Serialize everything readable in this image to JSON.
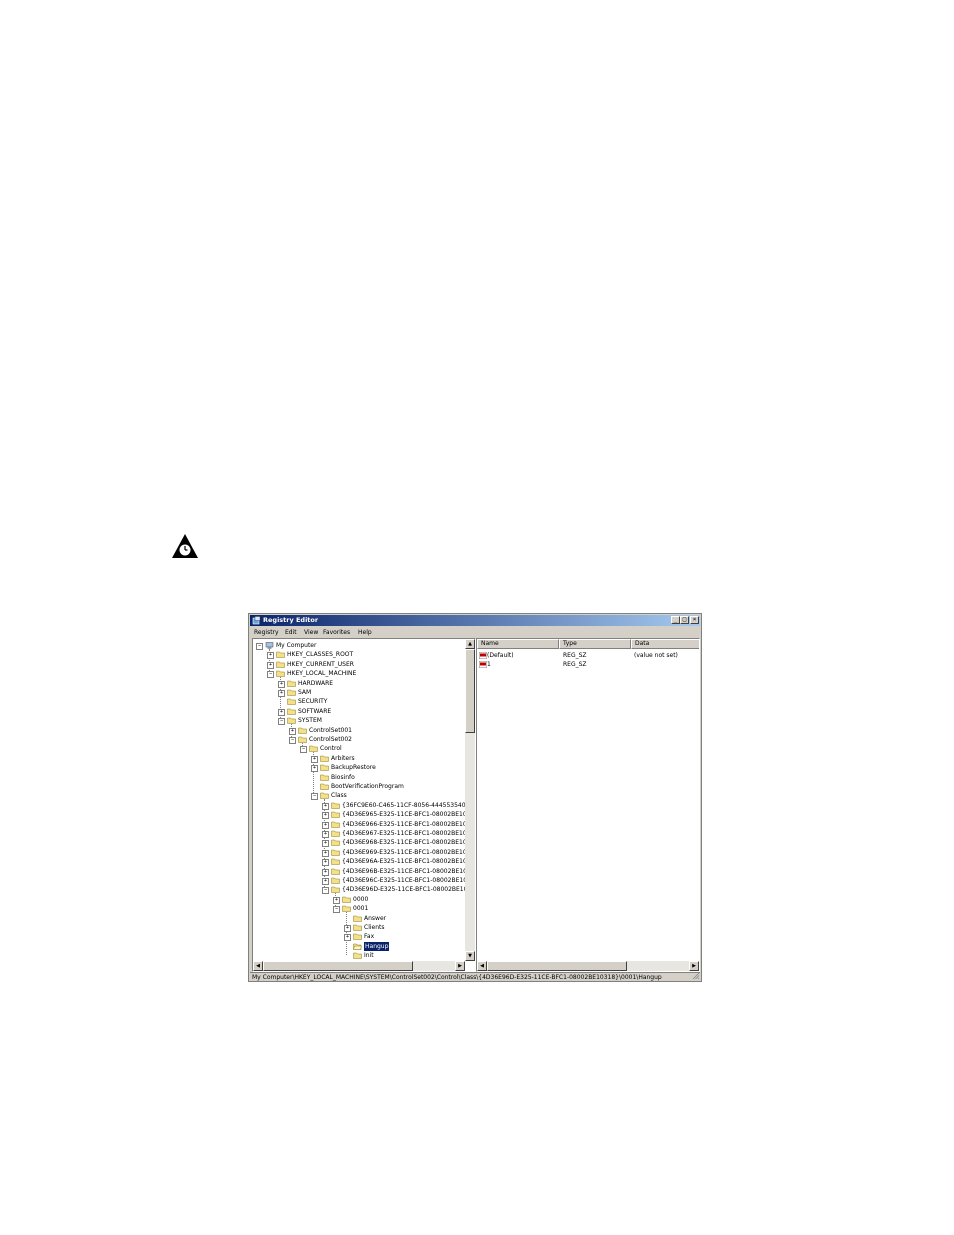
{
  "window": {
    "title": "Registry Editor",
    "minimize": "_",
    "maximize": "□",
    "close": "×"
  },
  "menu": [
    "Registry",
    "Edit",
    "View",
    "Favorites",
    "Help"
  ],
  "tree": [
    {
      "label": "My Computer",
      "level": 0,
      "exp": "-",
      "icon": "computer-icon"
    },
    {
      "label": "HKEY_CLASSES_ROOT",
      "level": 1,
      "exp": "+"
    },
    {
      "label": "HKEY_CURRENT_USER",
      "level": 1,
      "exp": "+"
    },
    {
      "label": "HKEY_LOCAL_MACHINE",
      "level": 1,
      "exp": "-"
    },
    {
      "label": "HARDWARE",
      "level": 2,
      "exp": "+"
    },
    {
      "label": "SAM",
      "level": 2,
      "exp": "+"
    },
    {
      "label": "SECURITY",
      "level": 2,
      "exp": ""
    },
    {
      "label": "SOFTWARE",
      "level": 2,
      "exp": "+"
    },
    {
      "label": "SYSTEM",
      "level": 2,
      "exp": "-"
    },
    {
      "label": "ControlSet001",
      "level": 3,
      "exp": "+"
    },
    {
      "label": "ControlSet002",
      "level": 3,
      "exp": "-"
    },
    {
      "label": "Control",
      "level": 4,
      "exp": "-"
    },
    {
      "label": "Arbiters",
      "level": 5,
      "exp": "+"
    },
    {
      "label": "BackupRestore",
      "level": 5,
      "exp": "+"
    },
    {
      "label": "Biosinfo",
      "level": 5,
      "exp": ""
    },
    {
      "label": "BootVerificationProgram",
      "level": 5,
      "exp": ""
    },
    {
      "label": "Class",
      "level": 5,
      "exp": "-"
    },
    {
      "label": "{36FC9E60-C465-11CF-8056-444553540",
      "level": 6,
      "exp": "+"
    },
    {
      "label": "{4D36E965-E325-11CE-BFC1-08002BE10",
      "level": 6,
      "exp": "+"
    },
    {
      "label": "{4D36E966-E325-11CE-BFC1-08002BE10",
      "level": 6,
      "exp": "+"
    },
    {
      "label": "{4D36E967-E325-11CE-BFC1-08002BE10",
      "level": 6,
      "exp": "+"
    },
    {
      "label": "{4D36E968-E325-11CE-BFC1-08002BE10",
      "level": 6,
      "exp": "+"
    },
    {
      "label": "{4D36E969-E325-11CE-BFC1-08002BE10",
      "level": 6,
      "exp": "+"
    },
    {
      "label": "{4D36E96A-E325-11CE-BFC1-08002BE10",
      "level": 6,
      "exp": "+"
    },
    {
      "label": "{4D36E96B-E325-11CE-BFC1-08002BE10",
      "level": 6,
      "exp": "+"
    },
    {
      "label": "{4D36E96C-E325-11CE-BFC1-08002BE10",
      "level": 6,
      "exp": "+"
    },
    {
      "label": "{4D36E96D-E325-11CE-BFC1-08002BE10",
      "level": 6,
      "exp": "-"
    },
    {
      "label": "0000",
      "level": 7,
      "exp": "+"
    },
    {
      "label": "0001",
      "level": 7,
      "exp": "-"
    },
    {
      "label": "Answer",
      "level": 8,
      "exp": ""
    },
    {
      "label": "Clients",
      "level": 8,
      "exp": "+"
    },
    {
      "label": "Fax",
      "level": 8,
      "exp": "+"
    },
    {
      "label": "Hangup",
      "level": 8,
      "exp": "",
      "selected": true,
      "open": true
    },
    {
      "label": "Init",
      "level": 8,
      "exp": ""
    }
  ],
  "list": {
    "columns": [
      "Name",
      "Type",
      "Data"
    ],
    "rows": [
      {
        "name": "(Default)",
        "type": "REG_SZ",
        "data": "(value not set)"
      },
      {
        "name": "1",
        "type": "REG_SZ",
        "data": ""
      }
    ]
  },
  "status": "My Computer\\HKEY_LOCAL_MACHINE\\SYSTEM\\ControlSet002\\Control\\Class\\{4D36E96D-E325-11CE-BFC1-08002BE10318}\\0001\\Hangup",
  "colors": {
    "titlebar": "#0a246a",
    "folder": "#f5e08a",
    "selection": "#0a246a"
  }
}
